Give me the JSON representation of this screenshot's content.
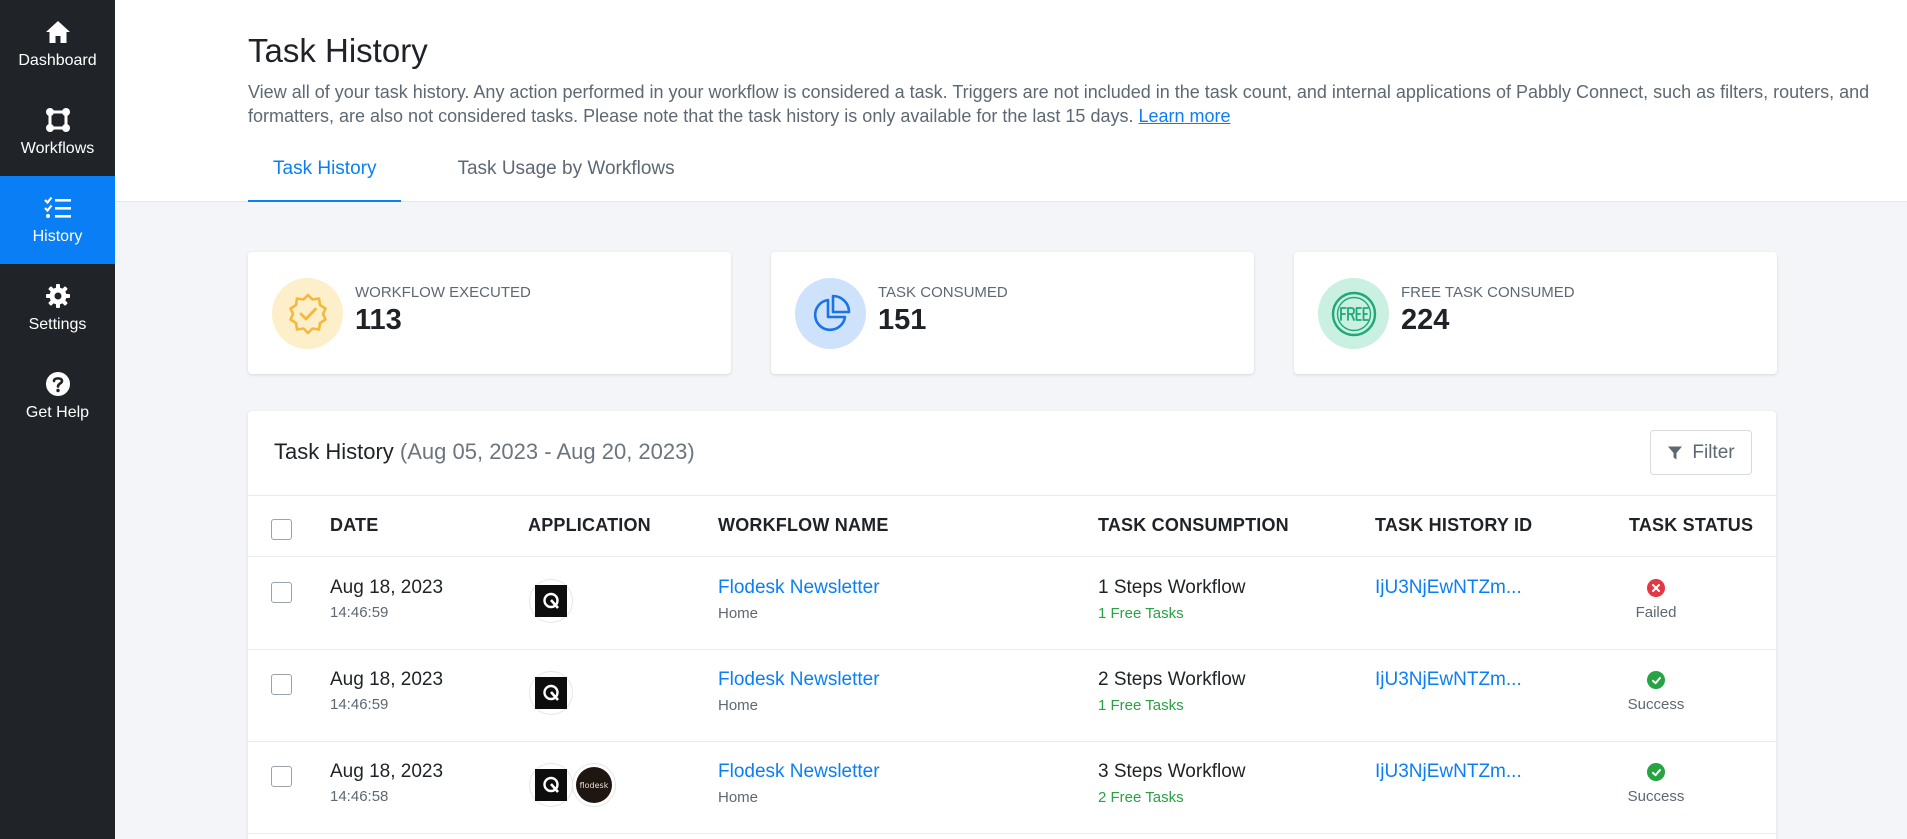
{
  "sidebar": {
    "items": [
      {
        "label": "Dashboard",
        "icon": "home-icon"
      },
      {
        "label": "Workflows",
        "icon": "workflows-icon"
      },
      {
        "label": "History",
        "icon": "history-list-icon",
        "active": true
      },
      {
        "label": "Settings",
        "icon": "gear-icon"
      },
      {
        "label": "Get Help",
        "icon": "question-icon"
      }
    ]
  },
  "header": {
    "title": "Task History",
    "description": "View all of your task history. Any action performed in your workflow is considered a task. Triggers are not included in the task count, and internal applications of Pabbly Connect, such as filters, routers, and formatters, are also not considered tasks. Please note that the task history is only available for the last 15 days.",
    "learn_more": "Learn more",
    "tabs": [
      {
        "label": "Task History",
        "active": true
      },
      {
        "label": "Task Usage by Workflows",
        "active": false
      }
    ]
  },
  "stats": [
    {
      "label": "WORKFLOW EXECUTED",
      "value": "113",
      "icon": "verified-badge-icon",
      "color": "#f5b83d"
    },
    {
      "label": "TASK CONSUMED",
      "value": "151",
      "icon": "pie-chart-icon",
      "color": "#1a73e8"
    },
    {
      "label": "FREE TASK CONSUMED",
      "value": "224",
      "icon": "free-badge-icon",
      "color": "#1fa87a"
    }
  ],
  "table": {
    "title": "Task History",
    "range": "(Aug 05, 2023 - Aug 20, 2023)",
    "filter_label": "Filter",
    "columns": [
      "DATE",
      "APPLICATION",
      "WORKFLOW NAME",
      "TASK CONSUMPTION",
      "TASK HISTORY ID",
      "TASK STATUS"
    ],
    "rows": [
      {
        "date": "Aug 18, 2023",
        "time": "14:46:59",
        "apps": [
          "app-q-icon"
        ],
        "workflow": "Flodesk Newsletter",
        "folder": "Home",
        "consumption": "1 Steps Workflow",
        "free": "1 Free Tasks",
        "id": "IjU3NjEwNTZm...",
        "status": "Failed"
      },
      {
        "date": "Aug 18, 2023",
        "time": "14:46:59",
        "apps": [
          "app-q-icon"
        ],
        "workflow": "Flodesk Newsletter",
        "folder": "Home",
        "consumption": "2 Steps Workflow",
        "free": "1 Free Tasks",
        "id": "IjU3NjEwNTZm...",
        "status": "Success"
      },
      {
        "date": "Aug 18, 2023",
        "time": "14:46:58",
        "apps": [
          "app-q-icon",
          "flodesk-logo-icon"
        ],
        "workflow": "Flodesk Newsletter",
        "folder": "Home",
        "consumption": "3 Steps Workflow",
        "free": "2 Free Tasks",
        "id": "IjU3NjEwNTZm...",
        "status": "Success"
      }
    ]
  },
  "flodesk_logo_text": "flodesk",
  "colors": {
    "accent": "#0a7ff5",
    "sidebar": "#202428",
    "success": "#27a344",
    "failed": "#e53845"
  }
}
